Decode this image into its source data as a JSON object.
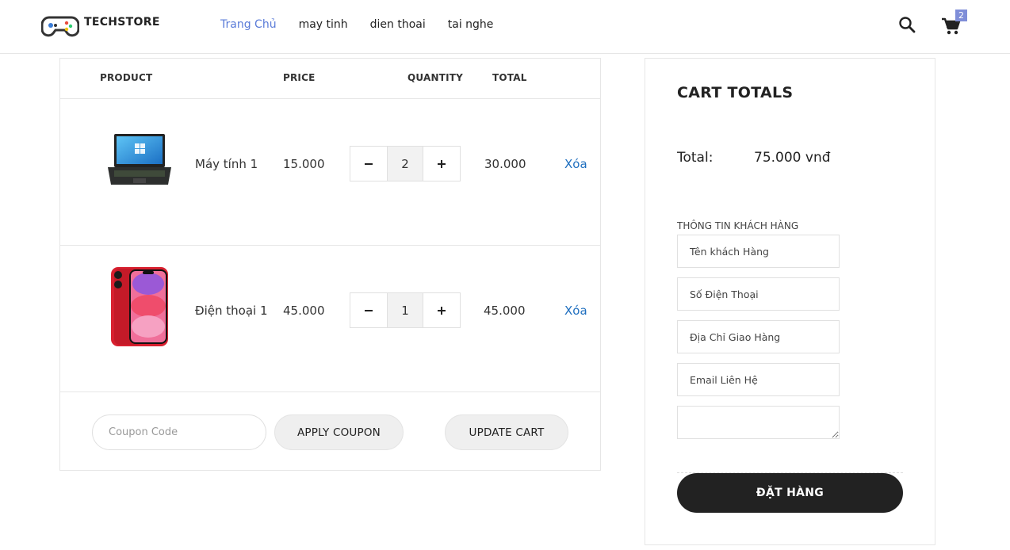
{
  "brand": {
    "name": "TECHSTORE"
  },
  "nav": [
    {
      "label": "Trang Chủ",
      "active": true
    },
    {
      "label": "may tinh",
      "active": false
    },
    {
      "label": "dien thoai",
      "active": false
    },
    {
      "label": "tai nghe",
      "active": false
    }
  ],
  "header": {
    "cart_count": "2"
  },
  "table": {
    "headers": {
      "product": "PRODUCT",
      "price": "PRICE",
      "quantity": "QUANTITY",
      "total": "TOTAL"
    },
    "rows": [
      {
        "name": "Máy tính 1",
        "price": "15.000",
        "qty": "2",
        "total": "30.000",
        "remove": "Xóa",
        "image": "laptop"
      },
      {
        "name": "Điện thoại 1",
        "price": "45.000",
        "qty": "1",
        "total": "45.000",
        "remove": "Xóa",
        "image": "red-iphone"
      }
    ],
    "coupon_placeholder": "Coupon Code",
    "apply_coupon": "APPLY COUPON",
    "update_cart": "UPDATE CART"
  },
  "totals": {
    "title": "CART TOTALS",
    "total_label": "Total:",
    "total_value": "75.000 vnđ",
    "customer_info_label": "THÔNG TIN KHÁCH HÀNG",
    "fields": {
      "name_placeholder": "Tên khách Hàng",
      "phone_placeholder": "Số Điện Thoại",
      "address_placeholder": "Địa Chỉ Giao Hàng",
      "email_placeholder": "Email Liên Hệ"
    },
    "order_button": "ĐẶT HÀNG"
  },
  "colors": {
    "nav_active": "#5a7bd8",
    "remove_link": "#1f6fbf",
    "badge": "#7f8ed8",
    "order_button": "#222222"
  }
}
